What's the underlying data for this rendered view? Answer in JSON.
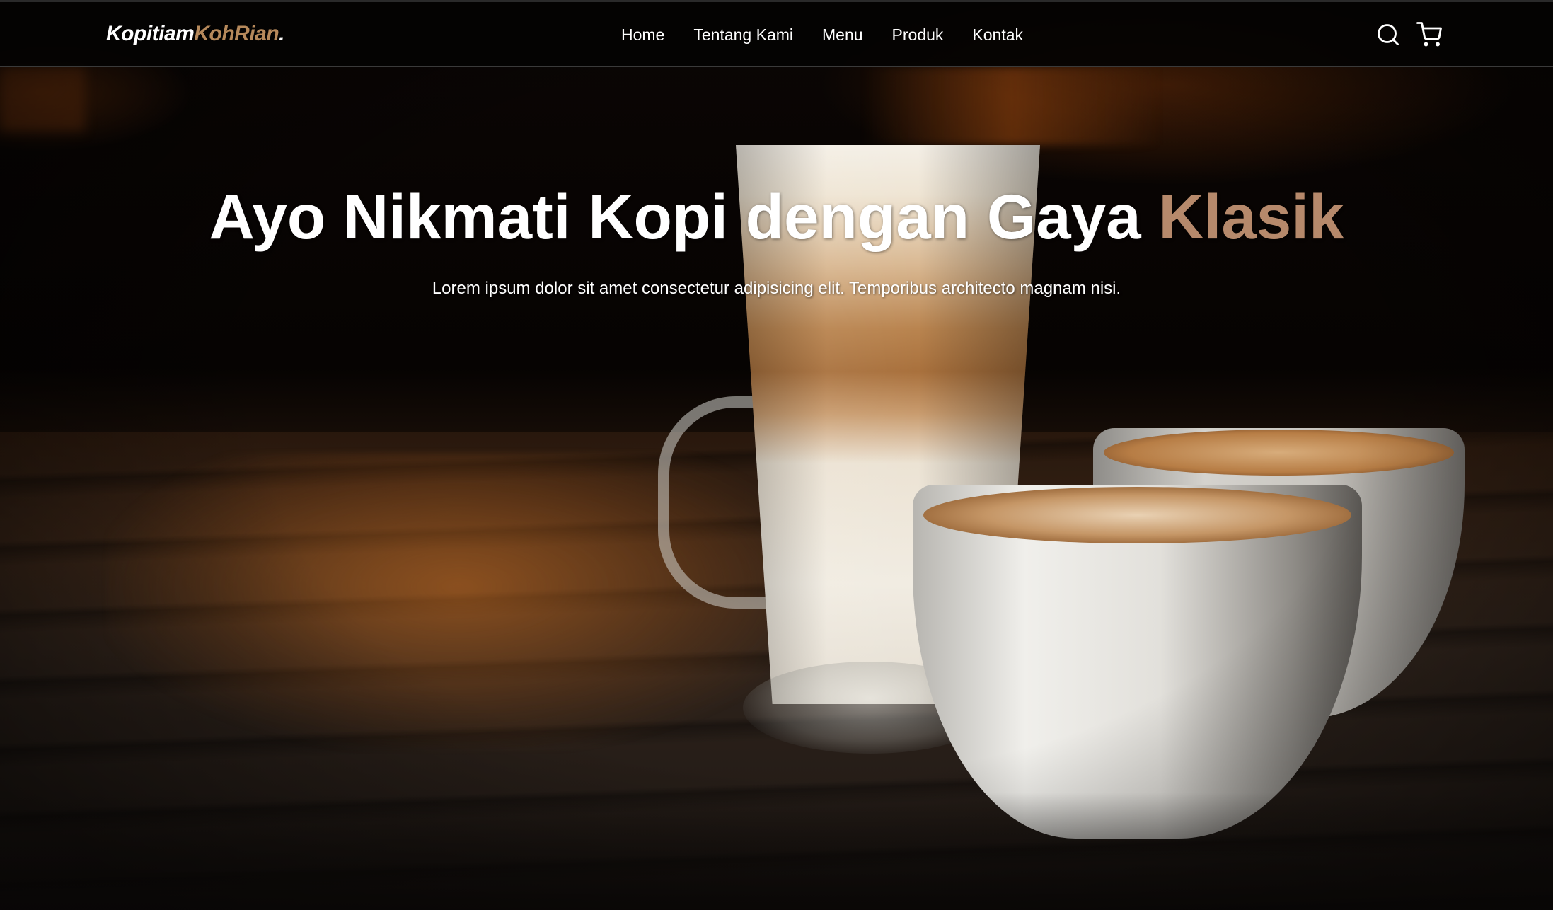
{
  "brand": {
    "part1": "Kopitiam",
    "part2": "KohRian",
    "part3": ".",
    "accent_color": "#b6895b"
  },
  "nav": {
    "items": [
      {
        "label": "Home"
      },
      {
        "label": "Tentang Kami"
      },
      {
        "label": "Menu"
      },
      {
        "label": "Produk"
      },
      {
        "label": "Kontak"
      }
    ],
    "icons": [
      "search-icon",
      "shopping-cart-icon"
    ]
  },
  "hero": {
    "title_main": "Ayo Nikmati Kopi dengan Gaya ",
    "title_accent": "Klasik",
    "subtitle": "Lorem ipsum dolor sit amet consectetur adipisicing elit. Temporibus architecto magnam nisi.",
    "accent_color": "#b6896b",
    "background_image": "latte glass and two cappuccino cups on a wooden table"
  }
}
